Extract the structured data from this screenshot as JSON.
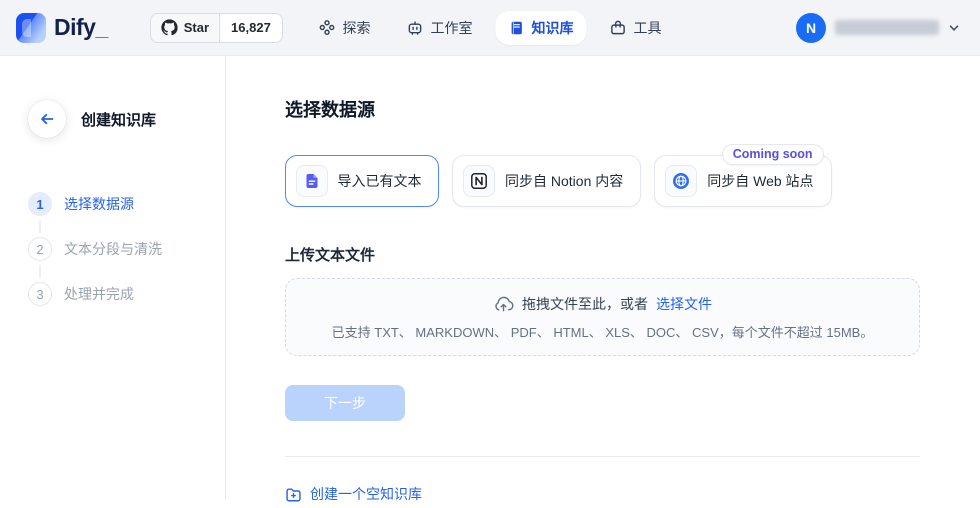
{
  "header": {
    "logo": {
      "name": "Dify",
      "suffix": "_"
    },
    "github": {
      "star_label": "Star",
      "star_count": "16,827"
    },
    "nav": [
      {
        "label": "探索",
        "icon": "explore-icon",
        "active": false
      },
      {
        "label": "工作室",
        "icon": "studio-icon",
        "active": false
      },
      {
        "label": "知识库",
        "icon": "knowledge-icon",
        "active": true
      },
      {
        "label": "工具",
        "icon": "tools-icon",
        "active": false
      }
    ],
    "account": {
      "avatar_initial": "N"
    }
  },
  "sidebar": {
    "title": "创建知识库",
    "steps": [
      {
        "number": "1",
        "label": "选择数据源",
        "state": "active"
      },
      {
        "number": "2",
        "label": "文本分段与清洗",
        "state": "pending"
      },
      {
        "number": "3",
        "label": "处理并完成",
        "state": "pending"
      }
    ]
  },
  "main": {
    "heading": "选择数据源",
    "sources": [
      {
        "label": "导入已有文本",
        "icon": "file-text-icon",
        "selected": true
      },
      {
        "label": "同步自 Notion 内容",
        "icon": "notion-icon",
        "selected": false
      },
      {
        "label": "同步自 Web 站点",
        "icon": "globe-icon",
        "selected": false,
        "badge": "Coming soon"
      }
    ],
    "upload": {
      "label": "上传文本文件",
      "drop_text": "拖拽文件至此，或者",
      "browse_link": "选择文件",
      "hint": "已支持 TXT、 MARKDOWN、 PDF、 HTML、 XLS、 DOC、 CSV，每个文件不超过 15MB。"
    },
    "next_button": "下一步",
    "empty_kb_link": "创建一个空知识库"
  },
  "colors": {
    "accent_blue": "#2563eb",
    "active_nav_blue": "#1d4fd8",
    "coming_soon_text": "#5551e8",
    "avatar_bg": "#1a6cf5",
    "header_bg": "#f2f4f7",
    "disabled_button_bg": "#b9d3fc",
    "selected_card_border": "#5187f7"
  }
}
